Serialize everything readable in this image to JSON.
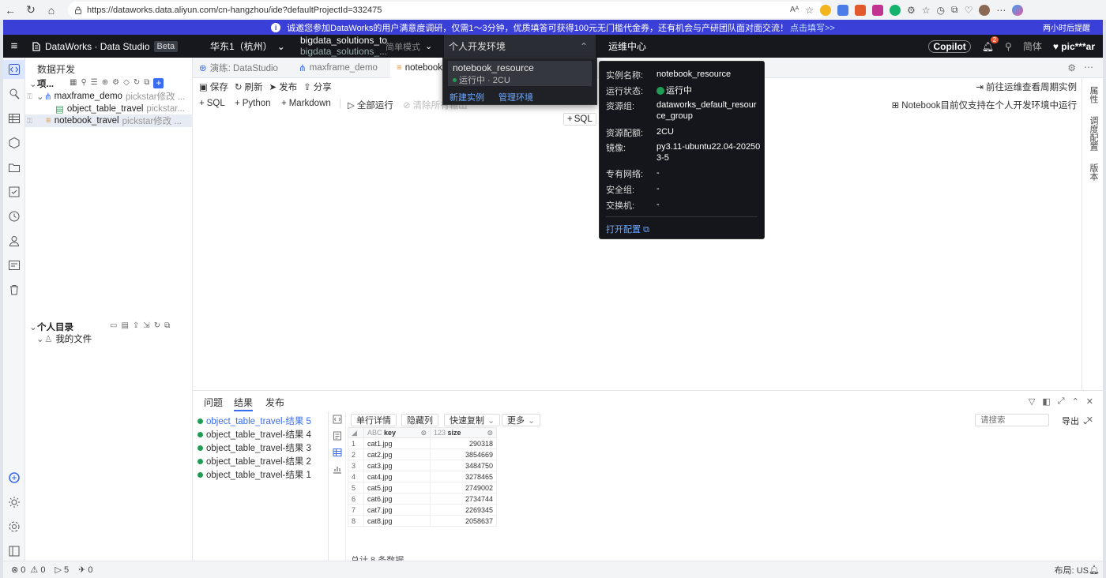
{
  "browser": {
    "url": "https://dataworks.data.aliyun.com/cn-hangzhou/ide?defaultProjectId=332475"
  },
  "notice": {
    "text": "诚邀您参加DataWorks的用户满意度调研，仅需1～3分钟，优质填答可获得100元无门槛代金券，还有机会与产研团队面对面交流！",
    "link": "点击填写>>",
    "later": "两小时后提醒"
  },
  "header": {
    "brand": "DataWorks · Data Studio",
    "beta": "Beta",
    "region": "华东1（杭州）",
    "project": "bigdata_solutions_to",
    "project_sub": "bigdata_solutions_...",
    "mode": "简单模式",
    "env_tab": "个人开发环境",
    "ops_center": "运维中心",
    "copilot": "Copilot",
    "notif_count": "2",
    "lang": "简体",
    "user": "pic***ar"
  },
  "explorer": {
    "title": "数据开发",
    "project_root": "项...",
    "items": [
      {
        "name": "maxframe_demo",
        "meta": "pickstar修改 ..."
      },
      {
        "name": "object_table_travel",
        "meta": "pickstar..."
      },
      {
        "name": "notebook_travel",
        "meta": "pickstar修改 ..."
      }
    ],
    "personal_dir": "个人目录",
    "my_files": "我的文件"
  },
  "tabs": [
    {
      "label": "演练: DataStudio"
    },
    {
      "label": "maxframe_demo"
    },
    {
      "label": "notebook"
    }
  ],
  "toolbar": {
    "save": "保存",
    "refresh": "刷新",
    "publish": "发布",
    "share": "分享",
    "goto_ops": "前往运维查看周期实例",
    "add_sql": "SQL",
    "add_python": "Python",
    "add_markdown": "Markdown",
    "run_all": "全部运行",
    "clear": "清除所有输出",
    "notebook_hint": "Notebook目前仅支持在个人开发环境中运行",
    "inline_sql": "SQL"
  },
  "right_rail": [
    "属性",
    "调度配置",
    "版本"
  ],
  "env_dropdown": {
    "resource": "notebook_resource",
    "status": "运行中 · 2CU",
    "new_instance": "新建实例",
    "manage_env": "管理环境"
  },
  "popover": {
    "fields": [
      {
        "label": "实例名称:",
        "value": "notebook_resource"
      },
      {
        "label": "运行状态:",
        "value": "运行中"
      },
      {
        "label": "资源组:",
        "value": "dataworks_default_resource_group"
      },
      {
        "label": "资源配额:",
        "value": "2CU"
      },
      {
        "label": "镜像:",
        "value": "py3.11-ubuntu22.04-202503-5"
      },
      {
        "label": "专有网络:",
        "value": "-"
      },
      {
        "label": "安全组:",
        "value": "-"
      },
      {
        "label": "交换机:",
        "value": "-"
      }
    ],
    "open_config": "打开配置"
  },
  "bottom": {
    "tabs": [
      "问题",
      "结果",
      "发布"
    ],
    "results": [
      "object_table_travel-结果 5",
      "object_table_travel-结果 4",
      "object_table_travel-结果 3",
      "object_table_travel-结果 2",
      "object_table_travel-结果 1"
    ],
    "actions": [
      "单行详情",
      "隐藏列",
      "快速复制",
      "更多"
    ],
    "search_placeholder": "请搜索",
    "export": "导出",
    "columns": [
      "key",
      "size"
    ],
    "rows": [
      [
        "1",
        "cat1.jpg",
        "290318"
      ],
      [
        "2",
        "cat2.jpg",
        "3854669"
      ],
      [
        "3",
        "cat3.jpg",
        "3484750"
      ],
      [
        "4",
        "cat4.jpg",
        "3278465"
      ],
      [
        "5",
        "cat5.jpg",
        "2749002"
      ],
      [
        "6",
        "cat6.jpg",
        "2734744"
      ],
      [
        "7",
        "cat7.jpg",
        "2269345"
      ],
      [
        "8",
        "cat8.jpg",
        "2058637"
      ]
    ],
    "total": "总计 8 条数据"
  },
  "status_bar": {
    "errors": "0",
    "warnings": "0",
    "runs": "5",
    "sends": "0",
    "layout": "布局: US"
  },
  "colors": {
    "accent": "#3a6cf2",
    "notice_bg": "#3a3fd8",
    "header_bg": "#16181d",
    "running": "#1f9d55"
  }
}
